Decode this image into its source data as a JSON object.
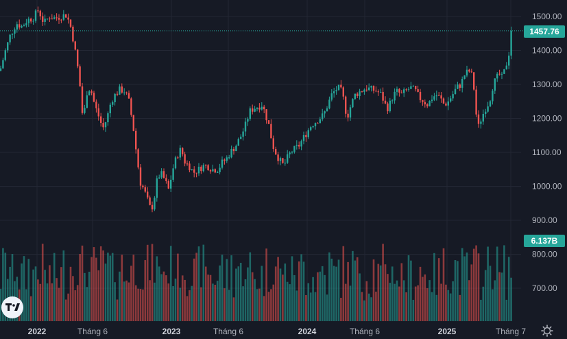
{
  "chart_data": {
    "type": "candlestick",
    "title": "",
    "y_axis": {
      "ticks": [
        "1500.00",
        "1400.00",
        "1300.00",
        "1200.00",
        "1100.00",
        "1000.00",
        "900.00",
        "800.00",
        "700.00"
      ],
      "range": [
        630,
        1530
      ]
    },
    "x_axis": {
      "ticks": [
        {
          "label": "2022",
          "bold": true,
          "pos": 54
        },
        {
          "label": "Tháng 6",
          "bold": false,
          "pos": 135
        },
        {
          "label": "2023",
          "bold": true,
          "pos": 250
        },
        {
          "label": "Tháng 6",
          "bold": false,
          "pos": 333
        },
        {
          "label": "2024",
          "bold": true,
          "pos": 448
        },
        {
          "label": "Tháng 6",
          "bold": false,
          "pos": 532
        },
        {
          "label": "2025",
          "bold": true,
          "pos": 652
        },
        {
          "label": "Tháng 7",
          "bold": false,
          "pos": 745
        }
      ]
    },
    "last_price": {
      "value": 1457.76,
      "label": "1457.76"
    },
    "last_volume": {
      "label": "6.137B"
    },
    "colors": {
      "up": "#26a69a",
      "down": "#ef5350",
      "background": "#161a25",
      "grid": "#232734",
      "axis_text": "#b2b5be",
      "price_line": "#26a69a"
    },
    "anchors": [
      [
        0,
        1340
      ],
      [
        8,
        1400
      ],
      [
        15,
        1445
      ],
      [
        24,
        1480
      ],
      [
        32,
        1470
      ],
      [
        40,
        1490
      ],
      [
        48,
        1495
      ],
      [
        56,
        1520
      ],
      [
        64,
        1480
      ],
      [
        72,
        1500
      ],
      [
        80,
        1495
      ],
      [
        88,
        1500
      ],
      [
        96,
        1505
      ],
      [
        102,
        1480
      ],
      [
        108,
        1420
      ],
      [
        114,
        1340
      ],
      [
        118,
        1270
      ],
      [
        121,
        1190
      ],
      [
        127,
        1280
      ],
      [
        132,
        1290
      ],
      [
        138,
        1240
      ],
      [
        145,
        1200
      ],
      [
        150,
        1170
      ],
      [
        156,
        1200
      ],
      [
        162,
        1250
      ],
      [
        168,
        1270
      ],
      [
        175,
        1285
      ],
      [
        182,
        1280
      ],
      [
        188,
        1250
      ],
      [
        194,
        1180
      ],
      [
        200,
        1080
      ],
      [
        205,
        1010
      ],
      [
        210,
        990
      ],
      [
        215,
        960
      ],
      [
        220,
        930
      ],
      [
        224,
        950
      ],
      [
        228,
        1010
      ],
      [
        234,
        1040
      ],
      [
        240,
        1020
      ],
      [
        246,
        990
      ],
      [
        252,
        1050
      ],
      [
        258,
        1090
      ],
      [
        264,
        1110
      ],
      [
        270,
        1070
      ],
      [
        276,
        1060
      ],
      [
        282,
        1040
      ],
      [
        290,
        1050
      ],
      [
        296,
        1060
      ],
      [
        302,
        1060
      ],
      [
        310,
        1050
      ],
      [
        318,
        1050
      ],
      [
        324,
        1070
      ],
      [
        330,
        1080
      ],
      [
        336,
        1100
      ],
      [
        344,
        1120
      ],
      [
        352,
        1150
      ],
      [
        358,
        1180
      ],
      [
        364,
        1220
      ],
      [
        370,
        1230
      ],
      [
        376,
        1235
      ],
      [
        382,
        1240
      ],
      [
        386,
        1220
      ],
      [
        392,
        1180
      ],
      [
        398,
        1120
      ],
      [
        404,
        1090
      ],
      [
        410,
        1070
      ],
      [
        414,
        1060
      ],
      [
        418,
        1080
      ],
      [
        424,
        1100
      ],
      [
        430,
        1110
      ],
      [
        436,
        1120
      ],
      [
        442,
        1140
      ],
      [
        448,
        1160
      ],
      [
        454,
        1180
      ],
      [
        460,
        1190
      ],
      [
        466,
        1200
      ],
      [
        472,
        1210
      ],
      [
        478,
        1240
      ],
      [
        484,
        1270
      ],
      [
        490,
        1285
      ],
      [
        496,
        1290
      ],
      [
        502,
        1250
      ],
      [
        506,
        1200
      ],
      [
        512,
        1240
      ],
      [
        518,
        1270
      ],
      [
        526,
        1280
      ],
      [
        534,
        1290
      ],
      [
        542,
        1285
      ],
      [
        550,
        1280
      ],
      [
        556,
        1270
      ],
      [
        562,
        1240
      ],
      [
        566,
        1230
      ],
      [
        572,
        1260
      ],
      [
        578,
        1280
      ],
      [
        586,
        1270
      ],
      [
        594,
        1285
      ],
      [
        600,
        1290
      ],
      [
        606,
        1280
      ],
      [
        612,
        1260
      ],
      [
        618,
        1250
      ],
      [
        624,
        1240
      ],
      [
        630,
        1260
      ],
      [
        636,
        1270
      ],
      [
        642,
        1260
      ],
      [
        648,
        1240
      ],
      [
        654,
        1250
      ],
      [
        660,
        1270
      ],
      [
        666,
        1290
      ],
      [
        672,
        1300
      ],
      [
        678,
        1330
      ],
      [
        684,
        1340
      ],
      [
        690,
        1320
      ],
      [
        693,
        1240
      ],
      [
        697,
        1170
      ],
      [
        702,
        1200
      ],
      [
        708,
        1230
      ],
      [
        714,
        1250
      ],
      [
        718,
        1290
      ],
      [
        722,
        1310
      ],
      [
        728,
        1330
      ],
      [
        732,
        1320
      ],
      [
        736,
        1340
      ],
      [
        740,
        1370
      ],
      [
        743,
        1400
      ],
      [
        747,
        1458
      ]
    ]
  }
}
